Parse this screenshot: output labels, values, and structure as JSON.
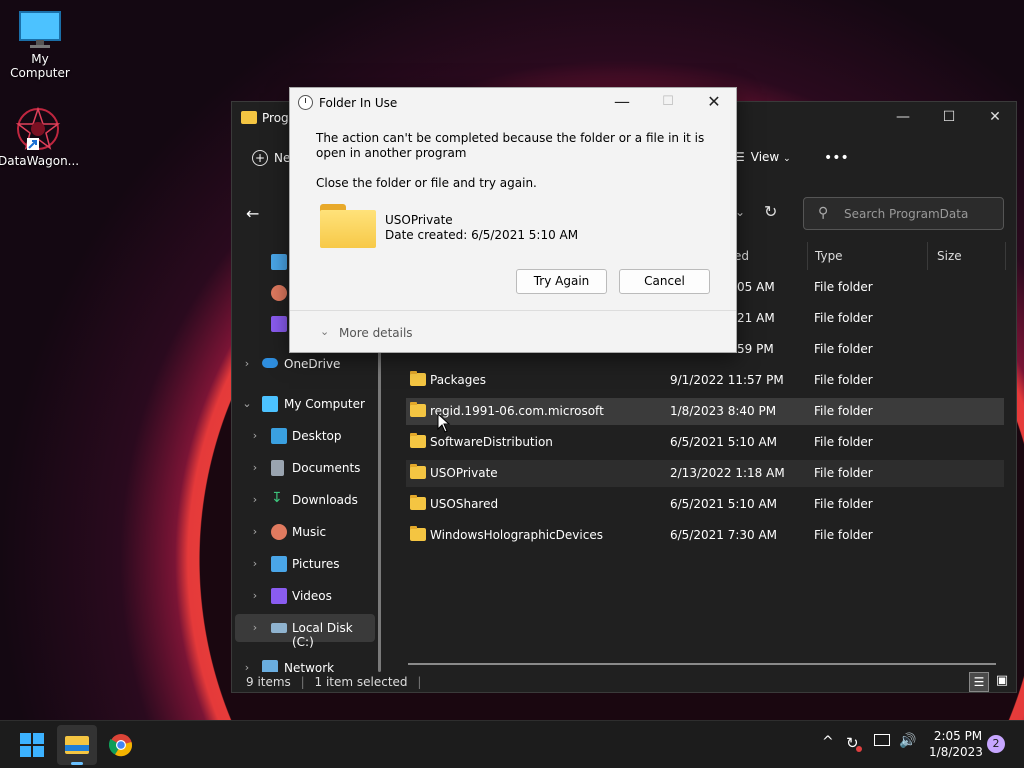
{
  "desktop": {
    "icons": [
      {
        "label": "My Computer"
      },
      {
        "label": "DataWagon..."
      }
    ]
  },
  "explorer": {
    "title": "Prog",
    "toolbar": {
      "new_label": "Ne",
      "view_label": "View",
      "more_label": "•••"
    },
    "search_placeholder": "Search ProgramData",
    "columns": {
      "date_partial": "ed",
      "type": "Type",
      "size": "Size"
    },
    "partial_rows": [
      {
        "date": ":05 AM",
        "type": "File folder"
      },
      {
        "date": ":21 AM",
        "type": "File folder"
      },
      {
        "date": ":59 PM",
        "type": "File folder"
      }
    ],
    "rows": [
      {
        "name": "Packages",
        "date": "9/1/2022 11:57 PM",
        "type": "File folder"
      },
      {
        "name": "regid.1991-06.com.microsoft",
        "date": "1/8/2023 8:40 PM",
        "type": "File folder"
      },
      {
        "name": "SoftwareDistribution",
        "date": "6/5/2021 5:10 AM",
        "type": "File folder"
      },
      {
        "name": "USOPrivate",
        "date": "2/13/2022 1:18 AM",
        "type": "File folder"
      },
      {
        "name": "USOShared",
        "date": "6/5/2021 5:10 AM",
        "type": "File folder"
      },
      {
        "name": "WindowsHolographicDevices",
        "date": "6/5/2021 7:30 AM",
        "type": "File folder"
      }
    ],
    "sidebar": {
      "onedrive": "OneDrive",
      "my_computer": "My Computer",
      "desktop": "Desktop",
      "documents": "Documents",
      "downloads": "Downloads",
      "music": "Music",
      "pictures": "Pictures",
      "videos": "Videos",
      "local_disk": "Local Disk (C:)",
      "network": "Network"
    },
    "status": {
      "items": "9 items",
      "selected": "1 item selected"
    }
  },
  "dialog": {
    "title": "Folder In Use",
    "message": "The action can't be completed because the folder or a file in it is open in another program",
    "instruction": "Close the folder or file and try again.",
    "folder_name": "USOPrivate",
    "folder_date": "Date created: 6/5/2021 5:10 AM",
    "try_again": "Try Again",
    "cancel": "Cancel",
    "more_details": "More details"
  },
  "taskbar": {
    "time": "2:05 PM",
    "date": "1/8/2023",
    "notification_count": "2"
  },
  "colors": {
    "accent": "#0078d4",
    "folder": "#f4c542"
  }
}
